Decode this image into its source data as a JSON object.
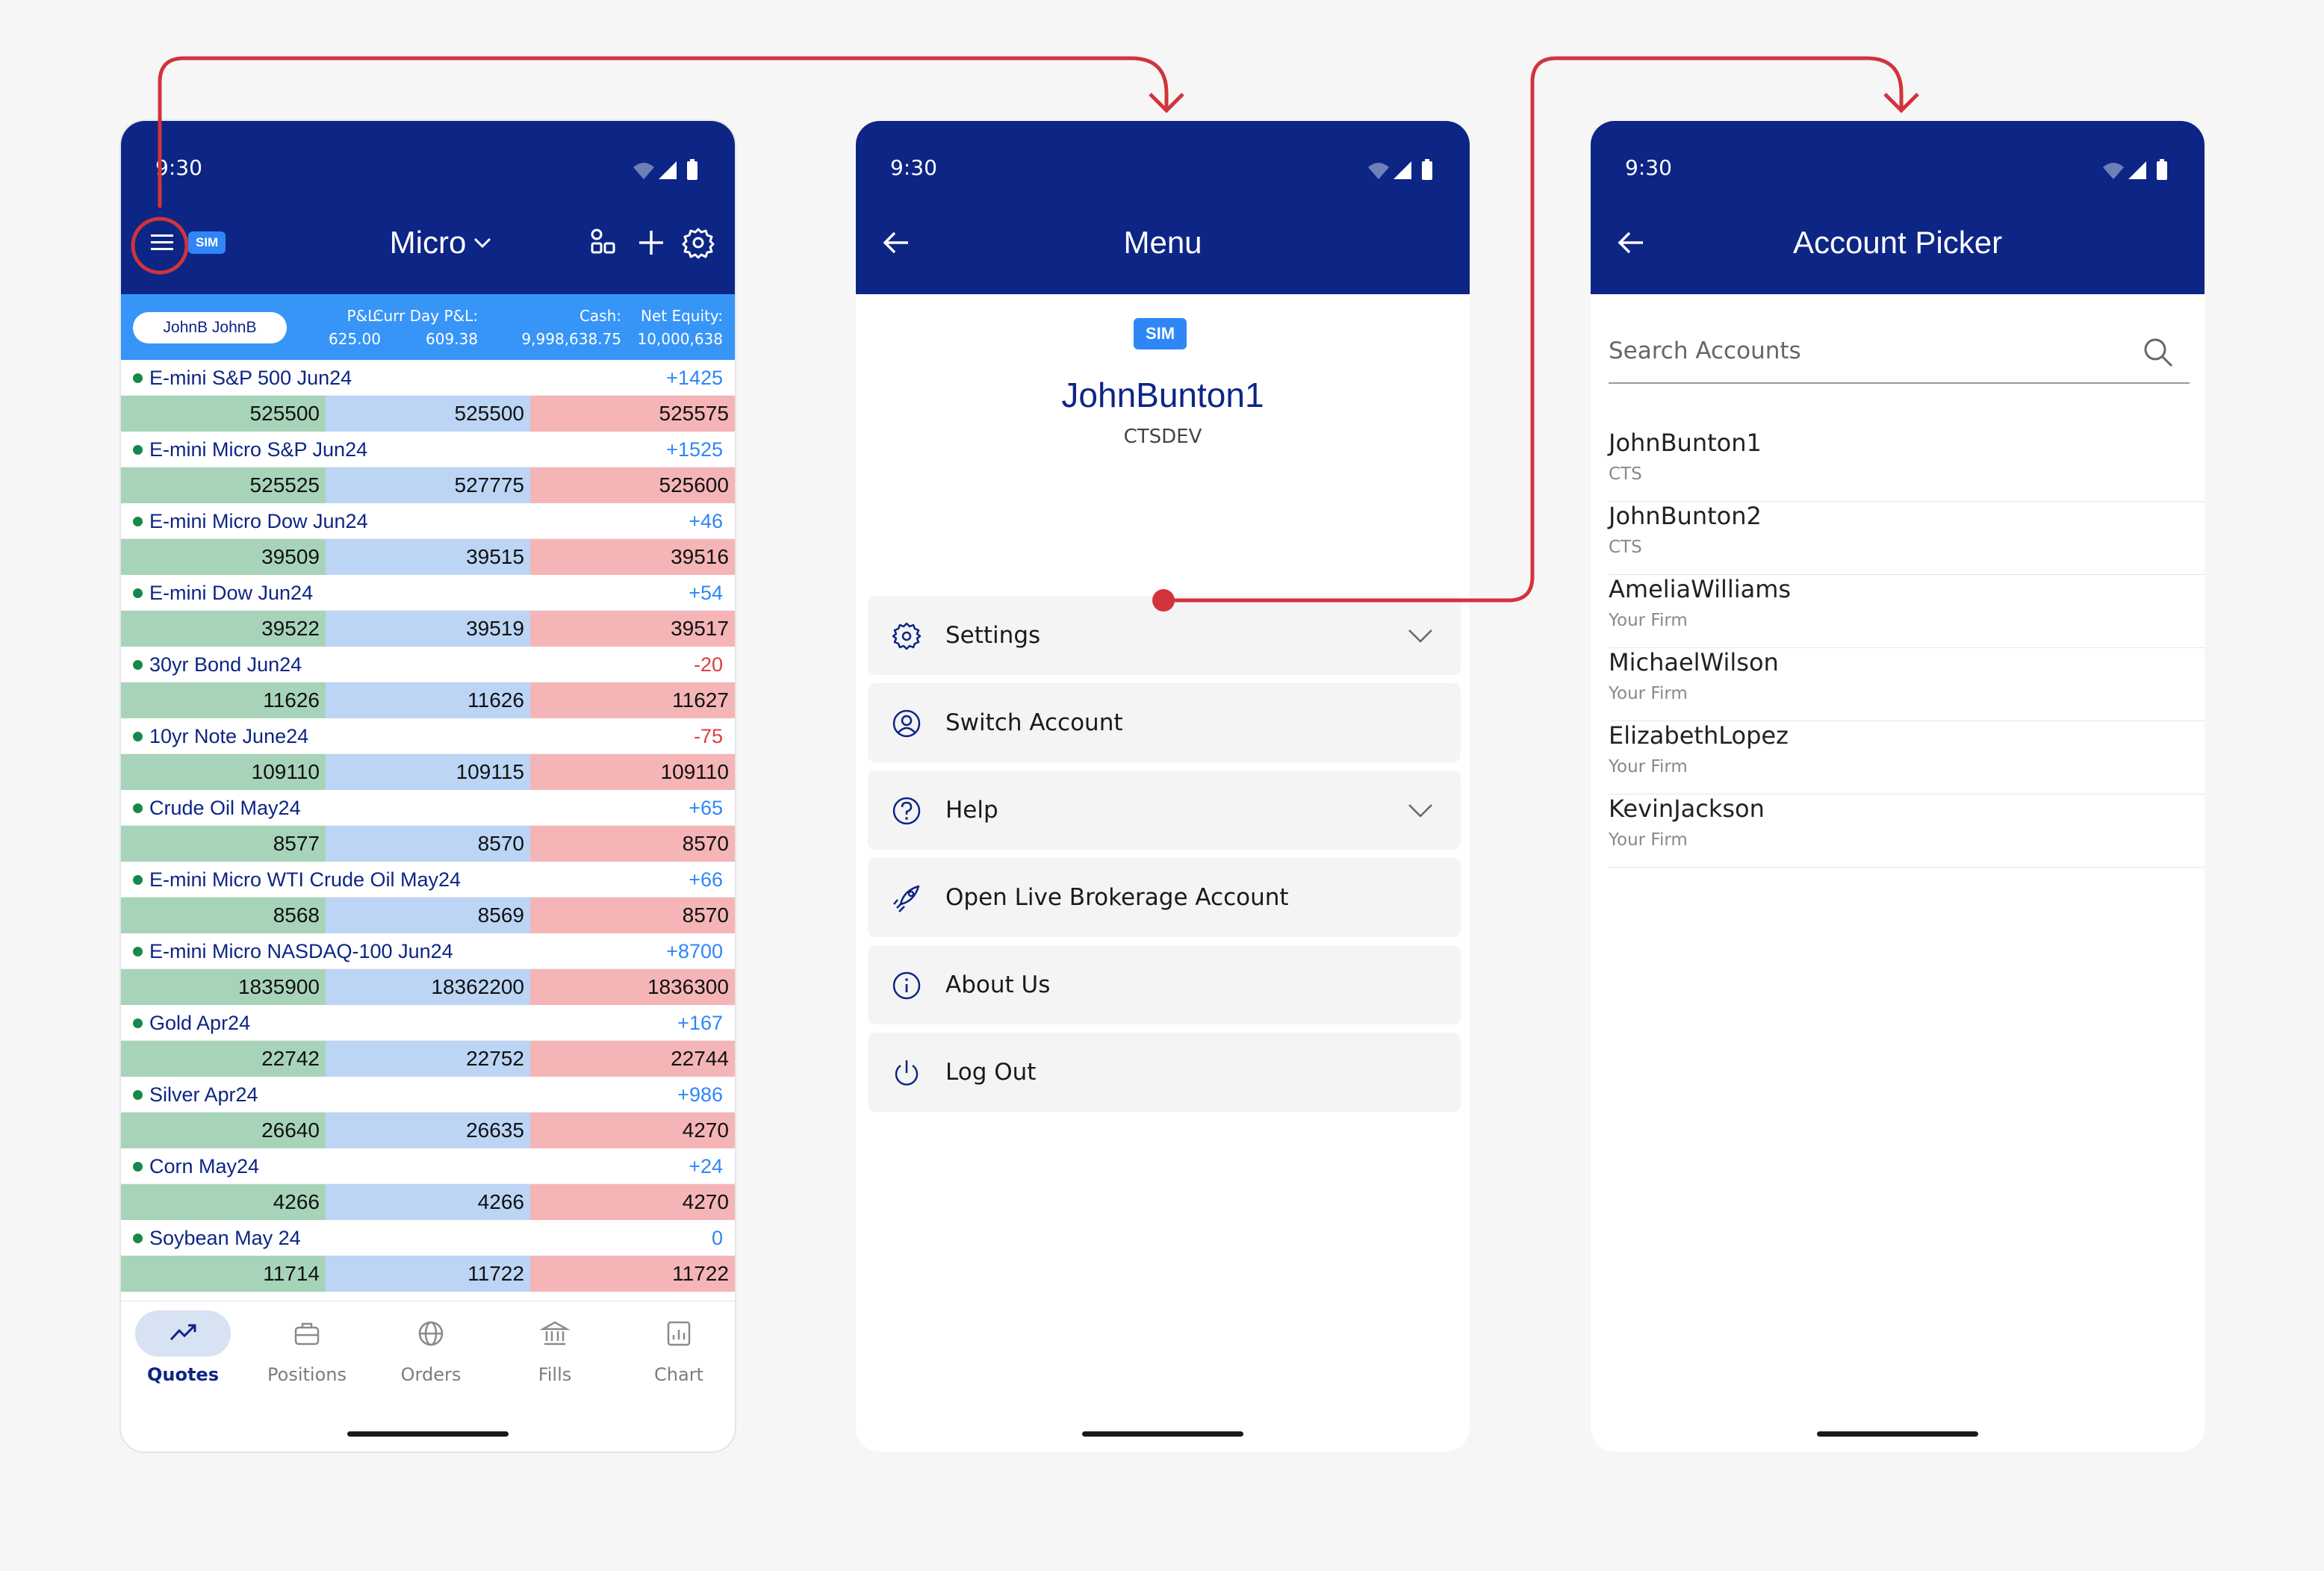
{
  "status": {
    "time": "9:30"
  },
  "quotes_screen": {
    "sim_badge": "SIM",
    "workspace": "Micro",
    "account": {
      "name": "JohnB JohnB",
      "pnl_label": "P&L:",
      "pnl": "625.00",
      "curr_day_label": "Curr Day P&L:",
      "curr_day": "609.38",
      "cash_label": "Cash:",
      "cash": "9,998,638.75",
      "equity_label": "Net Equity:",
      "equity": "10,000,638"
    },
    "quotes": [
      {
        "name": "E-mini S&P 500 Jun24",
        "change": "+1425",
        "bid": "525500",
        "last": "525500",
        "ask": "525575"
      },
      {
        "name": "E-mini Micro S&P Jun24",
        "change": "+1525",
        "bid": "525525",
        "last": "527775",
        "ask": "525600"
      },
      {
        "name": "E-mini Micro Dow Jun24",
        "change": "+46",
        "bid": "39509",
        "last": "39515",
        "ask": "39516"
      },
      {
        "name": "E-mini Dow Jun24",
        "change": "+54",
        "bid": "39522",
        "last": "39519",
        "ask": "39517"
      },
      {
        "name": "30yr Bond Jun24",
        "change": "-20",
        "bid": "11626",
        "last": "11626",
        "ask": "11627"
      },
      {
        "name": "10yr Note June24",
        "change": "-75",
        "bid": "109110",
        "last": "109115",
        "ask": "109110"
      },
      {
        "name": "Crude Oil May24",
        "change": "+65",
        "bid": "8577",
        "last": "8570",
        "ask": "8570"
      },
      {
        "name": "E-mini Micro WTI Crude Oil May24",
        "change": "+66",
        "bid": "8568",
        "last": "8569",
        "ask": "8570"
      },
      {
        "name": "E-mini Micro NASDAQ-100 Jun24",
        "change": "+8700",
        "bid": "1835900",
        "last": "18362200",
        "ask": "1836300"
      },
      {
        "name": "Gold Apr24",
        "change": "+167",
        "bid": "22742",
        "last": "22752",
        "ask": "22744"
      },
      {
        "name": "Silver Apr24",
        "change": "+986",
        "bid": "26640",
        "last": "26635",
        "ask": "4270"
      },
      {
        "name": "Corn May24",
        "change": "+24",
        "bid": "4266",
        "last": "4266",
        "ask": "4270"
      },
      {
        "name": "Soybean May 24",
        "change": "0",
        "bid": "11714",
        "last": "11722",
        "ask": "11722"
      }
    ],
    "nav": [
      {
        "label": "Quotes",
        "icon": "trending-up-icon",
        "active": true
      },
      {
        "label": "Positions",
        "icon": "briefcase-icon",
        "active": false
      },
      {
        "label": "Orders",
        "icon": "globe-icon",
        "active": false
      },
      {
        "label": "Fills",
        "icon": "bank-icon",
        "active": false
      },
      {
        "label": "Chart",
        "icon": "chart-icon",
        "active": false
      }
    ]
  },
  "menu_screen": {
    "title": "Menu",
    "sim": "SIM",
    "user": "JohnBunton1",
    "firm": "CTSDEV",
    "items": [
      {
        "label": "Settings",
        "icon": "gear-icon",
        "expandable": true
      },
      {
        "label": "Switch Account",
        "icon": "user-circle-icon",
        "expandable": false
      },
      {
        "label": "Help",
        "icon": "help-icon",
        "expandable": true
      },
      {
        "label": "Open Live Brokerage Account",
        "icon": "rocket-icon",
        "expandable": false
      },
      {
        "label": "About Us",
        "icon": "info-icon",
        "expandable": false
      },
      {
        "label": "Log Out",
        "icon": "power-icon",
        "expandable": false
      }
    ]
  },
  "account_picker": {
    "title": "Account Picker",
    "search_placeholder": "Search Accounts",
    "accounts": [
      {
        "name": "JohnBunton1",
        "firm": "CTS"
      },
      {
        "name": "JohnBunton2",
        "firm": "CTS"
      },
      {
        "name": "AmeliaWilliams",
        "firm": "Your Firm"
      },
      {
        "name": "MichaelWilson",
        "firm": "Your Firm"
      },
      {
        "name": "ElizabethLopez",
        "firm": "Your Firm"
      },
      {
        "name": "KevinJackson",
        "firm": "Your Firm"
      }
    ]
  },
  "colors": {
    "header": "#0d2585",
    "accent": "#2f86f6",
    "annotation": "#d1343c",
    "bid": "#a7d4b9",
    "last": "#bcd5f5",
    "ask": "#f5b5b7"
  }
}
